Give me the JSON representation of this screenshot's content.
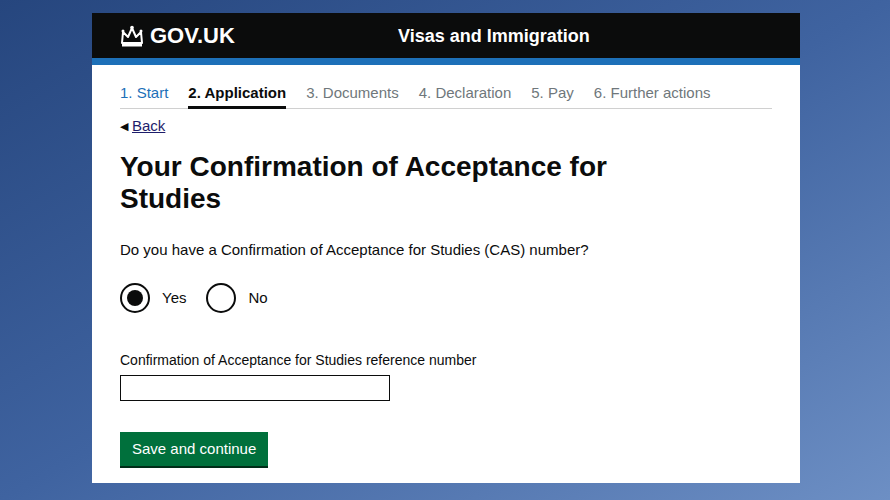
{
  "header": {
    "logo": "GOV.UK",
    "service": "Visas and Immigration"
  },
  "steps": [
    {
      "label": "1. Start",
      "selected": false,
      "completed": true
    },
    {
      "label": "2. Application",
      "selected": true,
      "completed": false
    },
    {
      "label": "3. Documents",
      "selected": false,
      "completed": false
    },
    {
      "label": "4. Declaration",
      "selected": false,
      "completed": false
    },
    {
      "label": "5. Pay",
      "selected": false,
      "completed": false
    },
    {
      "label": "6. Further actions",
      "selected": false,
      "completed": false
    }
  ],
  "back": {
    "icon": "◀",
    "label": "Back"
  },
  "heading": "Your Confirmation of Acceptance for Studies",
  "question": "Do you have a Confirmation of Acceptance for Studies (CAS) number?",
  "radios": [
    {
      "label": "Yes",
      "selected": true
    },
    {
      "label": "No",
      "selected": false
    }
  ],
  "field": {
    "label": "Confirmation of Acceptance for Studies reference number",
    "value": ""
  },
  "button": "Save and continue"
}
